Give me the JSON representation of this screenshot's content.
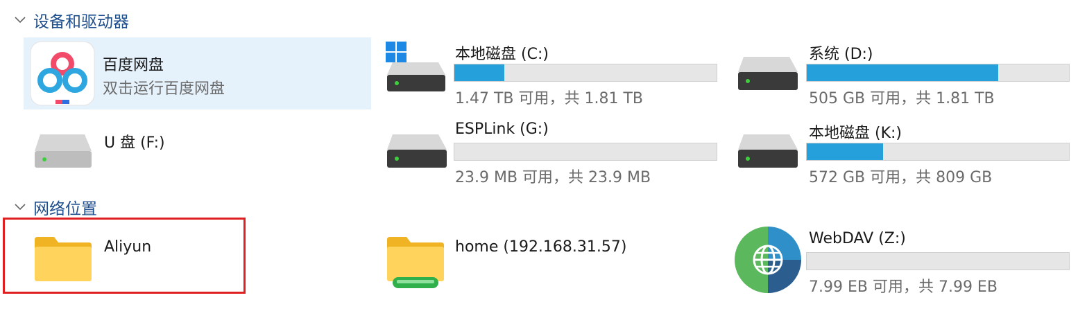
{
  "sections": {
    "devices": {
      "label": "设备和驱动器"
    },
    "network": {
      "label": "网络位置"
    }
  },
  "items": {
    "baidu": {
      "name": "百度网盘",
      "sub": "双击运行百度网盘",
      "icon": "baidu-netdisk-icon"
    },
    "c": {
      "name": "本地磁盘 (C:)",
      "sub": "1.47 TB 可用，共 1.81 TB",
      "used_fraction": 0.19,
      "icon": "windows-drive-icon"
    },
    "d": {
      "name": "系统 (D:)",
      "sub": "505 GB 可用，共 1.81 TB",
      "used_fraction": 0.73,
      "icon": "hard-drive-icon"
    },
    "f": {
      "name": "U 盘 (F:)",
      "icon": "hard-drive-icon"
    },
    "g": {
      "name": "ESPLink (G:)",
      "sub": "23.9 MB 可用，共 23.9 MB",
      "used_fraction": 0.0,
      "icon": "hard-drive-icon"
    },
    "k": {
      "name": "本地磁盘 (K:)",
      "sub": "572 GB 可用，共 809 GB",
      "used_fraction": 0.29,
      "icon": "hard-drive-icon"
    },
    "aliyun": {
      "name": "Aliyun",
      "icon": "folder-icon"
    },
    "home": {
      "name": "home (192.168.31.57)",
      "icon": "network-folder-icon"
    },
    "webdav": {
      "name": "WebDAV (Z:)",
      "sub": "7.99 EB 可用，共 7.99 EB",
      "used_fraction": 0.0,
      "icon": "globe-icon"
    }
  },
  "colors": {
    "accent_bar": "#26a0da",
    "selection": "#e5f1fb",
    "highlight": "#e02020",
    "section_title": "#1f4e8c"
  }
}
